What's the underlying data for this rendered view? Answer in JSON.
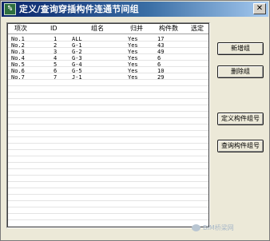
{
  "window": {
    "title": "定义/查询穿插构件连通节间组",
    "icon_label": "%",
    "icon_name": "app-icon",
    "close_label": "✕"
  },
  "table": {
    "columns": [
      "项次",
      "ID",
      "组名",
      "归并",
      "构件数",
      "选定"
    ],
    "rows": [
      {
        "idx": "No.1",
        "id": "1",
        "name": "ALL",
        "rev": "Yes",
        "cnt": "17",
        "sel": ""
      },
      {
        "idx": "No.2",
        "id": "2",
        "name": "G-1",
        "rev": "Yes",
        "cnt": "43",
        "sel": ""
      },
      {
        "idx": "No.3",
        "id": "3",
        "name": "G-2",
        "rev": "Yes",
        "cnt": "49",
        "sel": ""
      },
      {
        "idx": "No.4",
        "id": "4",
        "name": "G-3",
        "rev": "Yes",
        "cnt": "6",
        "sel": ""
      },
      {
        "idx": "No.5",
        "id": "5",
        "name": "G-4",
        "rev": "Yes",
        "cnt": "6",
        "sel": ""
      },
      {
        "idx": "No.6",
        "id": "6",
        "name": "G-5",
        "rev": "Yes",
        "cnt": "10",
        "sel": ""
      },
      {
        "idx": "No.7",
        "id": "7",
        "name": "J-1",
        "rev": "Yes",
        "cnt": "29",
        "sel": ""
      }
    ]
  },
  "buttons": {
    "add_group": "新增组",
    "delete_group": "删除组",
    "define_group_no": "定义构件组号",
    "query_group_no": "查询构件组号"
  },
  "watermark": {
    "text": "BIM桥梁网"
  },
  "colors": {
    "titlebar_start": "#0a246a",
    "titlebar_end": "#a6caf0",
    "dialog_bg": "#ece9d8",
    "grid_bg": "#ffffff"
  }
}
